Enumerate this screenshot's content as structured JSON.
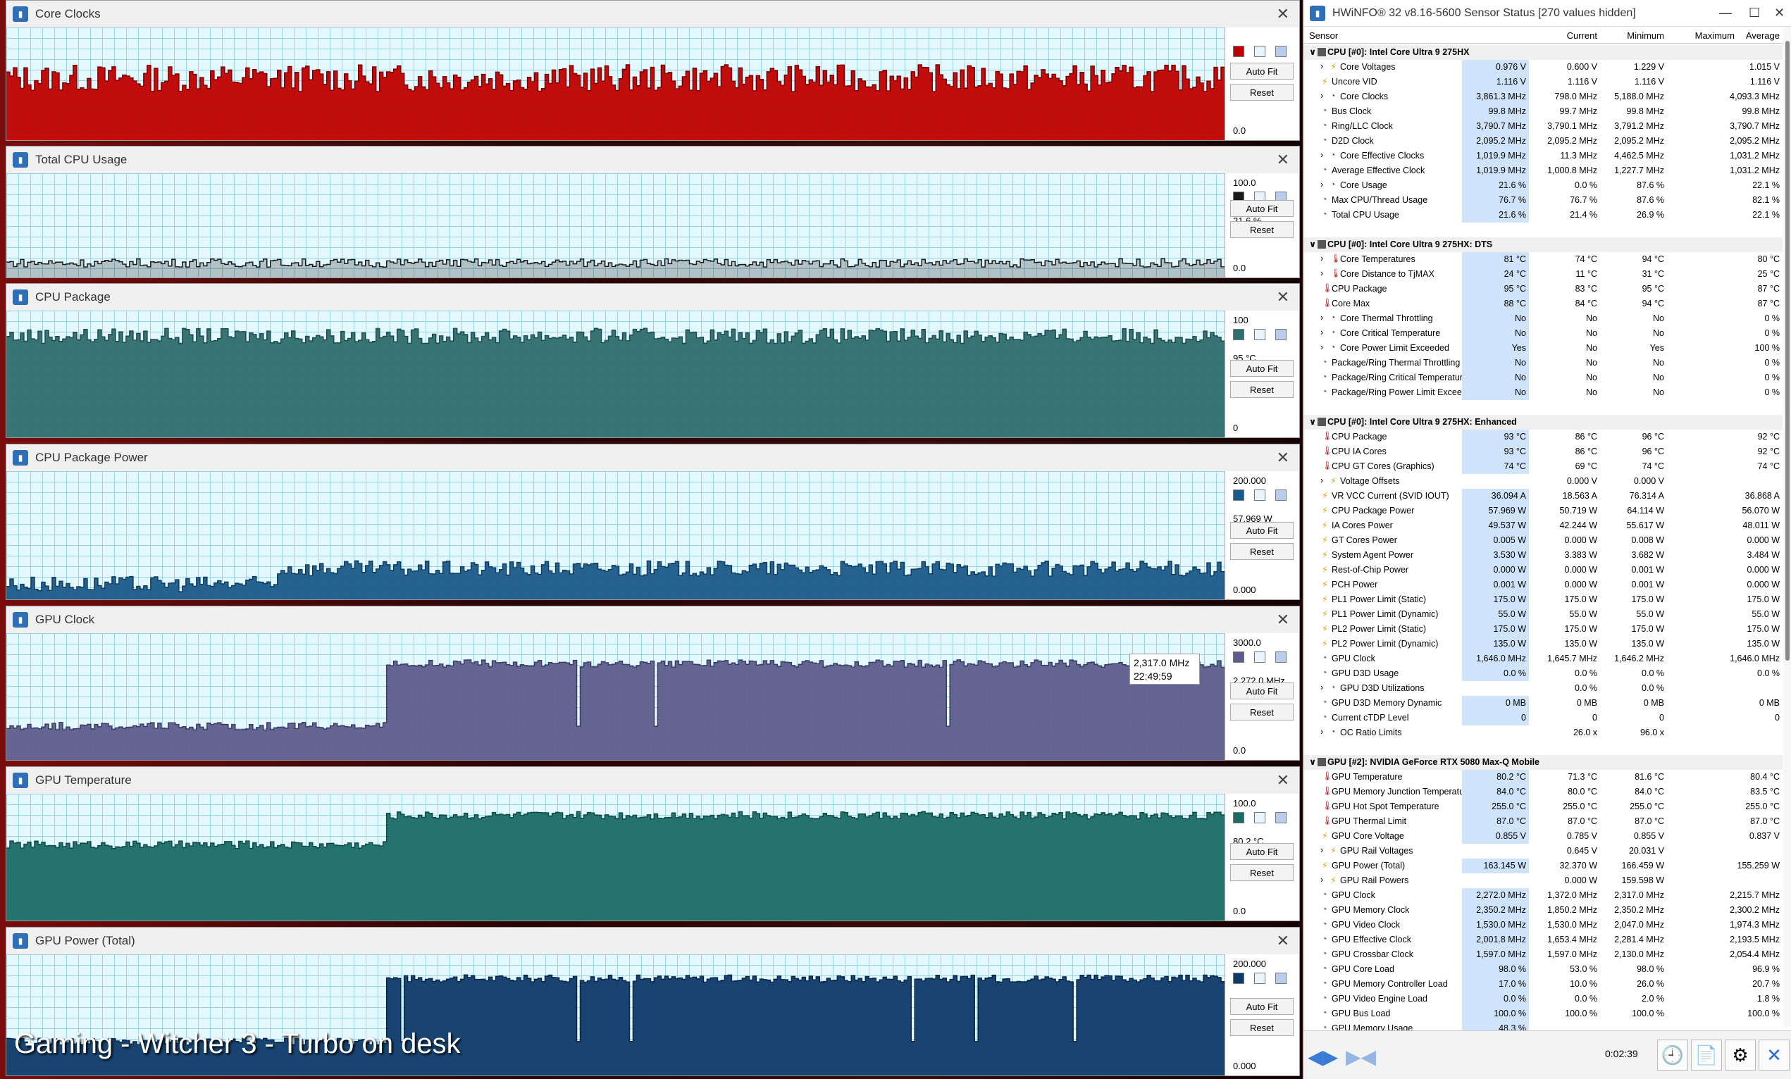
{
  "windows": [
    {
      "title": "Core Clocks",
      "max": "",
      "cur": "3,861.3 MHz",
      "min": "0.0",
      "color": "#c00000",
      "dark": "#7a0000",
      "level": [
        0.55,
        0.12
      ],
      "spikes": 0
    },
    {
      "title": "Total CPU Usage",
      "max": "100.0",
      "cur": "21.6 %",
      "min": "0.0",
      "color": "#1a1a1a",
      "dark": "#1a1a1a",
      "level": [
        0.14,
        0.04
      ],
      "spikes": 0
    },
    {
      "title": "CPU Package",
      "max": "100",
      "cur": "95 °C",
      "min": "0",
      "color": "#2e6d6d",
      "dark": "#1d4c4c",
      "level": [
        0.8,
        0.06
      ],
      "spikes": 0
    },
    {
      "title": "CPU Package Power",
      "max": "200.000",
      "cur": "57.969 W",
      "min": "0.000",
      "color": "#1a5a8a",
      "dark": "#113c5c",
      "level": [
        0.24,
        0.06
      ],
      "spikes": 0
    },
    {
      "title": "GPU Clock",
      "max": "3000.0",
      "cur": "2,272.0 MHz",
      "min": "0.0",
      "color": "#5d5d8c",
      "dark": "#3b3b63",
      "level": [
        0.76,
        0.03
      ],
      "spikes": 1
    },
    {
      "title": "GPU Temperature",
      "max": "100.0",
      "cur": "80.2 °C",
      "min": "0.0",
      "color": "#1a6b66",
      "dark": "#0e4a46",
      "level": [
        0.83,
        0.03
      ],
      "spikes": 0
    },
    {
      "title": "GPU Power (Total)",
      "max": "200.000",
      "cur": "163.145 W",
      "min": "0.000",
      "color": "#0e3a6a",
      "dark": "#082447",
      "level": [
        0.8,
        0.03
      ],
      "spikes": 1
    }
  ],
  "labels": {
    "auto_fit": "Auto Fit",
    "reset": "Reset"
  },
  "tooltip": {
    "value": "2,317.0 MHz",
    "time": "22:49:59"
  },
  "overlay_text": "Gaming - Witcher 3 - Turbo on desk",
  "hwinfo": {
    "title": "HWiNFO® 32 v8.16-5600 Sensor Status [270 values hidden]",
    "columns": [
      "Sensor",
      "Current",
      "Minimum",
      "Maximum",
      "Average"
    ],
    "timer": "0:02:39",
    "rows": [
      {
        "g": "CPU [#0]: Intel Core Ultra 9 275HX"
      },
      {
        "n": "Core Voltages",
        "i": 1,
        "e": 1,
        "t": "bolt",
        "v": [
          "0.976 V",
          "0.600 V",
          "1.229 V",
          "1.015 V"
        ]
      },
      {
        "n": "Uncore VID",
        "t": "bolt",
        "v": [
          "1.116 V",
          "1.116 V",
          "1.116 V",
          "1.116 V"
        ]
      },
      {
        "n": "Core Clocks",
        "i": 1,
        "e": 1,
        "t": "clock",
        "v": [
          "3,861.3 MHz",
          "798.0 MHz",
          "5,188.0 MHz",
          "4,093.3 MHz"
        ]
      },
      {
        "n": "Bus Clock",
        "t": "clock",
        "v": [
          "99.8 MHz",
          "99.7 MHz",
          "99.8 MHz",
          "99.8 MHz"
        ]
      },
      {
        "n": "Ring/LLC Clock",
        "t": "clock",
        "v": [
          "3,790.7 MHz",
          "3,790.1 MHz",
          "3,791.2 MHz",
          "3,790.7 MHz"
        ]
      },
      {
        "n": "D2D Clock",
        "t": "clock",
        "v": [
          "2,095.2 MHz",
          "2,095.2 MHz",
          "2,095.2 MHz",
          "2,095.2 MHz"
        ]
      },
      {
        "n": "Core Effective Clocks",
        "i": 1,
        "e": 1,
        "t": "clock",
        "v": [
          "1,019.9 MHz",
          "11.3 MHz",
          "4,462.5 MHz",
          "1,031.2 MHz"
        ]
      },
      {
        "n": "Average Effective Clock",
        "t": "clock",
        "v": [
          "1,019.9 MHz",
          "1,000.8 MHz",
          "1,227.7 MHz",
          "1,031.2 MHz"
        ]
      },
      {
        "n": "Core Usage",
        "i": 1,
        "e": 1,
        "t": "clock",
        "v": [
          "21.6 %",
          "0.0 %",
          "87.6 %",
          "22.1 %"
        ]
      },
      {
        "n": "Max CPU/Thread Usage",
        "t": "clock",
        "v": [
          "76.7 %",
          "76.7 %",
          "87.6 %",
          "82.1 %"
        ]
      },
      {
        "n": "Total CPU Usage",
        "t": "clock",
        "v": [
          "21.6 %",
          "21.4 %",
          "26.9 %",
          "22.1 %"
        ]
      },
      {
        "blank": 1
      },
      {
        "g": "CPU [#0]: Intel Core Ultra 9 275HX: DTS"
      },
      {
        "n": "Core Temperatures",
        "i": 1,
        "e": 1,
        "t": "therm",
        "v": [
          "81 °C",
          "74 °C",
          "94 °C",
          "80 °C"
        ]
      },
      {
        "n": "Core Distance to TjMAX",
        "i": 1,
        "e": 1,
        "t": "therm",
        "v": [
          "24 °C",
          "11 °C",
          "31 °C",
          "25 °C"
        ]
      },
      {
        "n": "CPU Package",
        "t": "therm",
        "v": [
          "95 °C",
          "83 °C",
          "95 °C",
          "87 °C"
        ]
      },
      {
        "n": "Core Max",
        "t": "therm",
        "v": [
          "88 °C",
          "84 °C",
          "94 °C",
          "87 °C"
        ]
      },
      {
        "n": "Core Thermal Throttling",
        "i": 1,
        "e": 1,
        "t": "clock",
        "v": [
          "No",
          "No",
          "No",
          "0 %"
        ]
      },
      {
        "n": "Core Critical Temperature",
        "i": 1,
        "e": 1,
        "t": "clock",
        "v": [
          "No",
          "No",
          "No",
          "0 %"
        ]
      },
      {
        "n": "Core Power Limit Exceeded",
        "i": 1,
        "e": 1,
        "t": "clock",
        "v": [
          "Yes",
          "No",
          "Yes",
          "100 %"
        ]
      },
      {
        "n": "Package/Ring Thermal Throttling",
        "t": "clock",
        "v": [
          "No",
          "No",
          "No",
          "0 %"
        ]
      },
      {
        "n": "Package/Ring Critical Temperature",
        "t": "clock",
        "v": [
          "No",
          "No",
          "No",
          "0 %"
        ]
      },
      {
        "n": "Package/Ring Power Limit Exceeded",
        "t": "clock",
        "v": [
          "No",
          "No",
          "No",
          "0 %"
        ]
      },
      {
        "blank": 1
      },
      {
        "g": "CPU [#0]: Intel Core Ultra 9 275HX: Enhanced"
      },
      {
        "n": "CPU Package",
        "t": "therm",
        "v": [
          "93 °C",
          "86 °C",
          "96 °C",
          "92 °C"
        ]
      },
      {
        "n": "CPU IA Cores",
        "t": "therm",
        "v": [
          "93 °C",
          "86 °C",
          "96 °C",
          "92 °C"
        ]
      },
      {
        "n": "CPU GT Cores (Graphics)",
        "t": "therm",
        "v": [
          "74 °C",
          "69 °C",
          "74 °C",
          "74 °C"
        ]
      },
      {
        "n": "Voltage Offsets",
        "i": 1,
        "e": 1,
        "t": "bolt",
        "v": [
          "",
          "0.000 V",
          "0.000 V",
          ""
        ]
      },
      {
        "n": "VR VCC Current (SVID IOUT)",
        "t": "bolt",
        "v": [
          "36.094 A",
          "18.563 A",
          "76.314 A",
          "36.868 A"
        ]
      },
      {
        "n": "CPU Package Power",
        "t": "bolt",
        "v": [
          "57.969 W",
          "50.719 W",
          "64.114 W",
          "56.070 W"
        ]
      },
      {
        "n": "IA Cores Power",
        "t": "bolt",
        "v": [
          "49.537 W",
          "42.244 W",
          "55.617 W",
          "48.011 W"
        ]
      },
      {
        "n": "GT Cores Power",
        "t": "bolt",
        "v": [
          "0.005 W",
          "0.000 W",
          "0.008 W",
          "0.000 W"
        ]
      },
      {
        "n": "System Agent Power",
        "t": "bolt",
        "v": [
          "3.530 W",
          "3.383 W",
          "3.682 W",
          "3.484 W"
        ]
      },
      {
        "n": "Rest-of-Chip Power",
        "t": "bolt",
        "v": [
          "0.000 W",
          "0.000 W",
          "0.001 W",
          "0.000 W"
        ]
      },
      {
        "n": "PCH Power",
        "t": "bolt",
        "v": [
          "0.001 W",
          "0.000 W",
          "0.001 W",
          "0.000 W"
        ]
      },
      {
        "n": "PL1 Power Limit (Static)",
        "t": "bolt",
        "v": [
          "175.0 W",
          "175.0 W",
          "175.0 W",
          "175.0 W"
        ]
      },
      {
        "n": "PL1 Power Limit (Dynamic)",
        "t": "bolt",
        "v": [
          "55.0 W",
          "55.0 W",
          "55.0 W",
          "55.0 W"
        ]
      },
      {
        "n": "PL2 Power Limit (Static)",
        "t": "bolt",
        "v": [
          "175.0 W",
          "175.0 W",
          "175.0 W",
          "175.0 W"
        ]
      },
      {
        "n": "PL2 Power Limit (Dynamic)",
        "t": "bolt",
        "v": [
          "135.0 W",
          "135.0 W",
          "135.0 W",
          "135.0 W"
        ]
      },
      {
        "n": "GPU Clock",
        "t": "clock",
        "v": [
          "1,646.0 MHz",
          "1,645.7 MHz",
          "1,646.2 MHz",
          "1,646.0 MHz"
        ]
      },
      {
        "n": "GPU D3D Usage",
        "t": "clock",
        "v": [
          "0.0 %",
          "0.0 %",
          "0.0 %",
          "0.0 %"
        ]
      },
      {
        "n": "GPU D3D Utilizations",
        "i": 1,
        "e": 1,
        "t": "clock",
        "v": [
          "",
          "0.0 %",
          "0.0 %",
          ""
        ]
      },
      {
        "n": "GPU D3D Memory Dynamic",
        "t": "clock",
        "v": [
          "0 MB",
          "0 MB",
          "0 MB",
          "0 MB"
        ]
      },
      {
        "n": "Current cTDP Level",
        "t": "clock",
        "v": [
          "0",
          "0",
          "0",
          "0"
        ]
      },
      {
        "n": "OC Ratio Limits",
        "i": 1,
        "e": 1,
        "t": "clock",
        "v": [
          "",
          "26.0 x",
          "96.0 x",
          ""
        ]
      },
      {
        "blank": 1
      },
      {
        "g": "GPU [#2]: NVIDIA  GeForce RTX 5080 Max-Q Mobile"
      },
      {
        "n": "GPU Temperature",
        "t": "therm",
        "v": [
          "80.2 °C",
          "71.3 °C",
          "81.6 °C",
          "80.4 °C"
        ]
      },
      {
        "n": "GPU Memory Junction Temperature",
        "t": "therm",
        "v": [
          "84.0 °C",
          "80.0 °C",
          "84.0 °C",
          "83.5 °C"
        ]
      },
      {
        "n": "GPU Hot Spot Temperature",
        "t": "therm",
        "v": [
          "255.0 °C",
          "255.0 °C",
          "255.0 °C",
          "255.0 °C"
        ]
      },
      {
        "n": "GPU Thermal Limit",
        "t": "therm",
        "v": [
          "87.0 °C",
          "87.0 °C",
          "87.0 °C",
          "87.0 °C"
        ]
      },
      {
        "n": "GPU Core Voltage",
        "t": "bolt",
        "v": [
          "0.855 V",
          "0.785 V",
          "0.855 V",
          "0.837 V"
        ]
      },
      {
        "n": "GPU Rail Voltages",
        "i": 1,
        "e": 1,
        "t": "bolt",
        "v": [
          "",
          "0.645 V",
          "20.031 V",
          ""
        ]
      },
      {
        "n": "GPU Power (Total)",
        "t": "bolt",
        "v": [
          "163.145 W",
          "32.370 W",
          "166.459 W",
          "155.259 W"
        ]
      },
      {
        "n": "GPU Rail Powers",
        "i": 1,
        "e": 1,
        "t": "bolt",
        "v": [
          "",
          "0.000 W",
          "159.598 W",
          ""
        ]
      },
      {
        "n": "GPU Clock",
        "t": "clock",
        "v": [
          "2,272.0 MHz",
          "1,372.0 MHz",
          "2,317.0 MHz",
          "2,215.7 MHz"
        ]
      },
      {
        "n": "GPU Memory Clock",
        "t": "clock",
        "v": [
          "2,350.2 MHz",
          "1,850.2 MHz",
          "2,350.2 MHz",
          "2,300.2 MHz"
        ]
      },
      {
        "n": "GPU Video Clock",
        "t": "clock",
        "v": [
          "1,530.0 MHz",
          "1,530.0 MHz",
          "2,047.0 MHz",
          "1,974.3 MHz"
        ]
      },
      {
        "n": "GPU Effective Clock",
        "t": "clock",
        "v": [
          "2,001.8 MHz",
          "1,653.4 MHz",
          "2,281.4 MHz",
          "2,193.5 MHz"
        ]
      },
      {
        "n": "GPU Crossbar Clock",
        "t": "clock",
        "v": [
          "1,597.0 MHz",
          "1,597.0 MHz",
          "2,130.0 MHz",
          "2,054.4 MHz"
        ]
      },
      {
        "n": "GPU Core Load",
        "t": "clock",
        "v": [
          "98.0 %",
          "53.0 %",
          "98.0 %",
          "96.9 %"
        ]
      },
      {
        "n": "GPU Memory Controller Load",
        "t": "clock",
        "v": [
          "17.0 %",
          "10.0 %",
          "26.0 %",
          "20.7 %"
        ]
      },
      {
        "n": "GPU Video Engine Load",
        "t": "clock",
        "v": [
          "0.0 %",
          "0.0 %",
          "2.0 %",
          "1.8 %"
        ]
      },
      {
        "n": "GPU Bus Load",
        "t": "clock",
        "v": [
          "100.0 %",
          "100.0 %",
          "100.0 %",
          "100.0 %"
        ]
      },
      {
        "n": "GPU Memory Usage",
        "t": "clock",
        "v": [
          "48.3 %",
          "",
          "",
          ""
        ]
      }
    ]
  }
}
